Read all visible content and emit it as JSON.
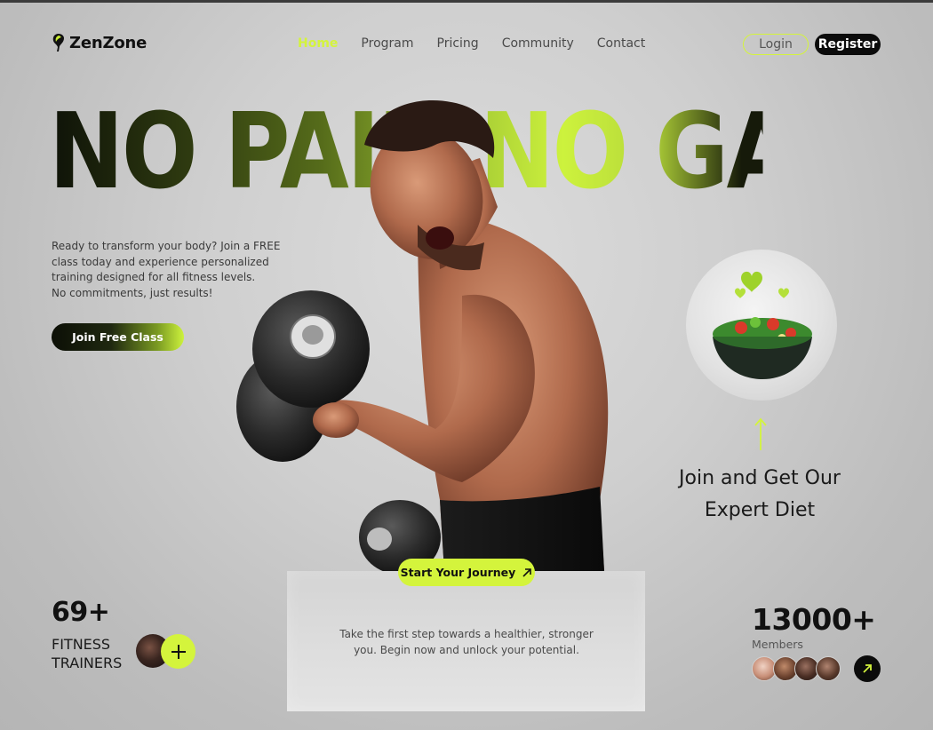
{
  "brand": {
    "name": "ZenZone"
  },
  "nav": {
    "items": [
      {
        "label": "Home",
        "active": true
      },
      {
        "label": "Program",
        "active": false
      },
      {
        "label": "Pricing",
        "active": false
      },
      {
        "label": "Community",
        "active": false
      },
      {
        "label": "Contact",
        "active": false
      }
    ],
    "login_label": "Login",
    "register_label": "Register"
  },
  "hero": {
    "headline": "NO PAIN NO GAIN",
    "intro_lines": [
      "Ready to transform your body? Join a FREE",
      "class today and experience personalized",
      "training designed for all fitness levels.",
      "No commitments, just results!"
    ],
    "cta_label": "Join Free Class"
  },
  "diet": {
    "title_line1": "Join and Get Our",
    "title_line2": "Expert Diet"
  },
  "journey": {
    "cta_label": "Start Your Journey",
    "text_line1": "Take the first step towards a healthier, stronger",
    "text_line2": "you. Begin now and unlock your potential."
  },
  "stats": {
    "trainers_count": "69+",
    "trainers_label_line1": "FITNESS",
    "trainers_label_line2": "TRAINERS",
    "members_count": "13000+",
    "members_label": "Members"
  },
  "colors": {
    "accent": "#d4f43c",
    "dark": "#0b0b0b",
    "background": "#cfcfcf"
  },
  "icons": {
    "logo": "leaf-bulb-icon",
    "journey_arrow": "arrow-up-right-icon",
    "plus": "plus-icon",
    "members_arrow": "arrow-up-right-icon",
    "diet_arrow": "arrow-up-icon"
  }
}
